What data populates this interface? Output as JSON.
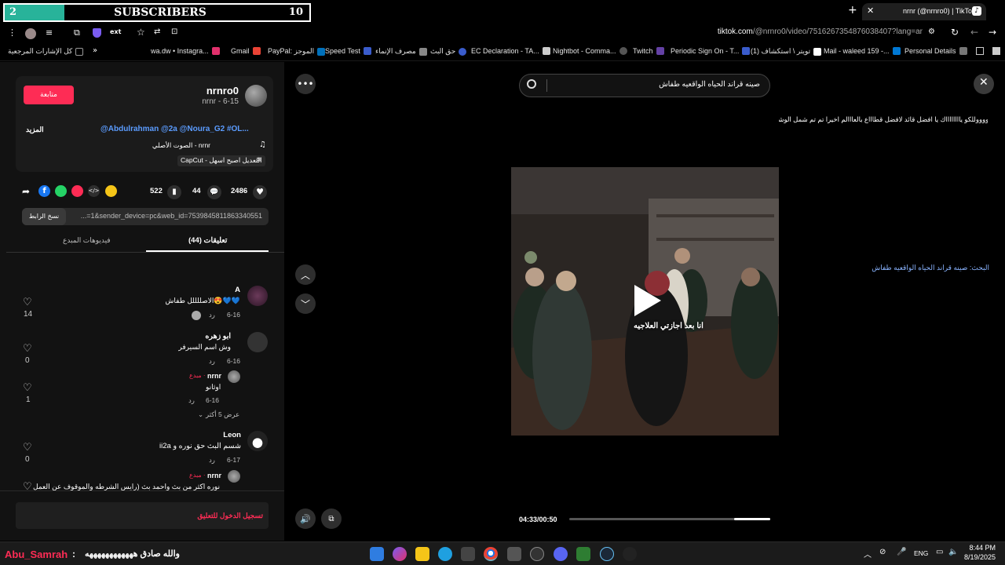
{
  "overlay": {
    "left_number": "2",
    "label": "SUBSCRIBERS",
    "right_number": "10"
  },
  "browser": {
    "tab_title": "nrnr (@nrnro0) | TikTok",
    "url_domain": "tiktok.com",
    "url_path": "/@nrnro0/video/7516267354876038407?lang=ar",
    "bookmarks": [
      {
        "label": "كل الإشارات المرجعية",
        "color": "#999999"
      },
      {
        "label": "wa.dw • Instagra...",
        "color": "#e1306c"
      },
      {
        "label": "Gmail",
        "color": "#ea4335"
      },
      {
        "label": "PayPal: الموجز",
        "color": "#0070ba"
      },
      {
        "label": "Speed Test",
        "color": "#3a5ccc"
      },
      {
        "label": "مصرف الإنماء",
        "color": "#888888"
      },
      {
        "label": "حق البث",
        "color": "#c0392b"
      },
      {
        "label": "EC Declaration - TA...",
        "color": "#3a5ccc"
      },
      {
        "label": "Nightbot - Comma...",
        "color": "#888888"
      },
      {
        "label": "Twitch",
        "color": "#6441a5"
      },
      {
        "label": "Periodic Sign On - T...",
        "color": "#3a5ccc"
      },
      {
        "label": "(1) تويتر \\ استكشاف",
        "color": "#ffffff"
      },
      {
        "label": "Mail - waleed 159 -...",
        "color": "#0078d4"
      },
      {
        "label": "Personal Details",
        "color": "#888888"
      }
    ]
  },
  "post": {
    "username": "nrnro0",
    "meta": "nrnr - 6-15",
    "follow_label": "متابعة",
    "caption_line1": "ووووووللكو يااااااااك يا افضل قائد لافضل قطاااع بالعااالم اخيرا تم تم شمل الوشنات بعد تفكك 😌",
    "caption_line2": "@Abdulrahman @2a @Noura_G2 #OL...",
    "more_label": "المزيد",
    "sound_label": "الصوت الأصلي - nrnr",
    "capcut_label": "CapCut - التعديل اصبح اسهل",
    "likes": "2486",
    "comments": "44",
    "saves": "522",
    "link_text": "...=1&sender_device=pc&web_id=7539845811863340551",
    "copy_link_label": "نسخ الرابط",
    "tab_comments": "تعليقات (44)",
    "tab_creator_videos": "فيديوهات المبدع"
  },
  "search_hint": {
    "label": "البحث: صينه قراند الحياه الواقعيه طفاش"
  },
  "comments": [
    {
      "name": "A",
      "text": "الاصللللل طفاش😍💙💙",
      "date": "6-16",
      "reply": "رد",
      "likes": "14"
    },
    {
      "name": "ابو زهره",
      "text": "وش اسم السيرفر",
      "date": "6-16",
      "reply": "رد",
      "likes": "0"
    },
    {
      "name": "nrnr",
      "creator_tag": "مبدع ·",
      "text": "اوثانو",
      "date": "6-16",
      "reply": "رد",
      "likes": "1"
    },
    {
      "name": "Leon",
      "text": "ii2a شسم البث حق نوره و",
      "date": "6-17",
      "reply": "رد",
      "likes": "0"
    },
    {
      "name": "nrnr",
      "creator_tag": "مبدع ·",
      "text": "نوره اكثر من بث واحمد بث (رايس الشرطه والموقوف عن العمل"
    }
  ],
  "show_more_replies": "عرض 5 أكثر",
  "login_prompt": "تسجيل الدخول للتعليق",
  "video": {
    "search_text": "صينه قراند الحياه الواقعيه طفاش",
    "subtitle": "انا بعد اجازتي العلاجيه",
    "time": "04:33/00:50",
    "progress": 0.82
  },
  "stream_chat": {
    "user": "Abu_Samrah",
    "separator": " : ",
    "message": "والله صادق ههههههههههههه"
  },
  "taskbar": {
    "lang": "ENG",
    "time": "8:44 PM",
    "date": "8/19/2025"
  }
}
